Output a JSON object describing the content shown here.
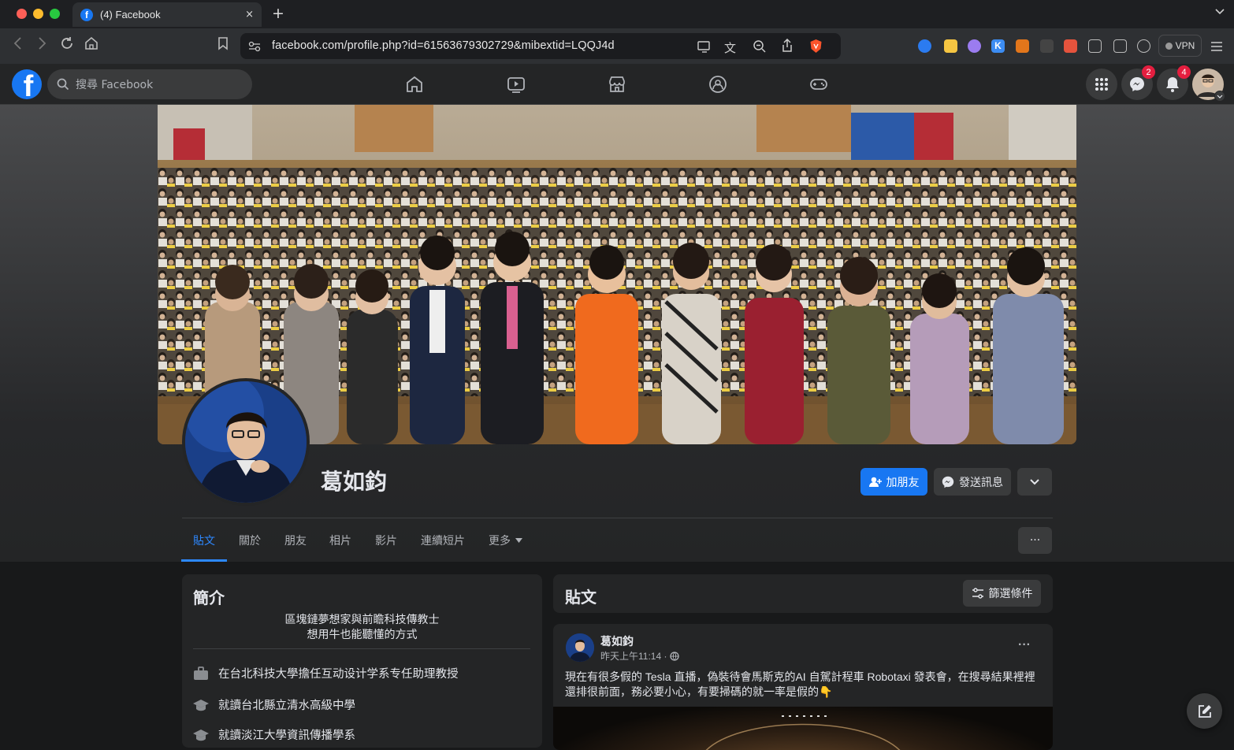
{
  "browser": {
    "tab_title": "(4) Facebook",
    "tab_close": "×",
    "new_tab": "+",
    "url": "facebook.com/profile.php?id=61563679302729&mibextid=LQQJ4d",
    "vpn_label": "VPN"
  },
  "header": {
    "logo_letter": "f",
    "search_placeholder": "搜尋 Facebook",
    "messenger_badge": "2",
    "notifications_badge": "4",
    "brand_color": "#1877f2"
  },
  "profile": {
    "name": "葛如鈞",
    "add_friend": "加朋友",
    "send_message": "發送訊息",
    "tabs": [
      "貼文",
      "關於",
      "朋友",
      "相片",
      "影片",
      "連續短片",
      "更多"
    ],
    "more_dots": "···"
  },
  "intro": {
    "title": "簡介",
    "bio_line1": "區塊鏈夢想家與前瞻科技傳教士",
    "bio_line2": "想用牛也能聽懂的方式",
    "items": [
      "在台北科技大學擔任互动设计学系专任助理教授",
      "就讀台北縣立清水高級中學",
      "就讀淡江大學資訊傳播學系"
    ]
  },
  "posts": {
    "title": "貼文",
    "filter_label": "篩選條件",
    "post": {
      "author": "葛如鈞",
      "time": "昨天上午11:14 ·",
      "text_line1": "現在有很多假的 Tesla 直播，偽裝待會馬斯克的AI 自駕計程車 Robotaxi 發表會，在搜尋結果裡裡",
      "text_line2": "還排很前面，務必要小心，有要掃碼的就一率是假的👇",
      "menu": "···"
    }
  }
}
